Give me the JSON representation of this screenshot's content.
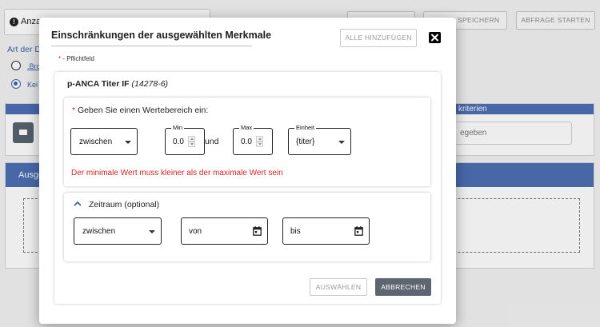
{
  "background": {
    "count_selector_label": "Anzah",
    "buttons": [
      {
        "label": ""
      },
      {
        "label": "ABFRAGE SPEICHERN"
      },
      {
        "label": "ABFRAGE STARTEN"
      }
    ],
    "data_type_label": "Art der Da",
    "radio_options": [
      {
        "label": ".Bro",
        "selected": false
      },
      {
        "label": "Kei",
        "selected": true
      }
    ],
    "criteria_header": "kriterien",
    "criteria_input_text": "egeben",
    "selected_features_header": "Ausge"
  },
  "modal": {
    "title": "Einschränkungen der ausgewählten Merkmale",
    "add_all_button": "ALLE HINZUFÜGEN",
    "required_note": "- Pflichtfeld",
    "required_star": "*",
    "feature": {
      "name": "p-ANCA Titer IF",
      "code": "(14278-6)"
    },
    "range": {
      "prompt": "Geben Sie einen Wertebereich ein:",
      "operator": "zwischen",
      "min_label": "Min",
      "min_value": "0.0",
      "conjunction": "und",
      "max_label": "Max",
      "max_value": "0.0",
      "unit_label": "Einheit",
      "unit_value": "{titer}",
      "error": "Der minimale Wert muss kleiner als der maximale Wert sein"
    },
    "timespan": {
      "label": "Zeitraum (optional)",
      "operator": "zwischen",
      "from": "von",
      "to": "bis"
    },
    "select_button": "AUSWÄHLEN",
    "cancel_button": "ABBRECHEN"
  }
}
